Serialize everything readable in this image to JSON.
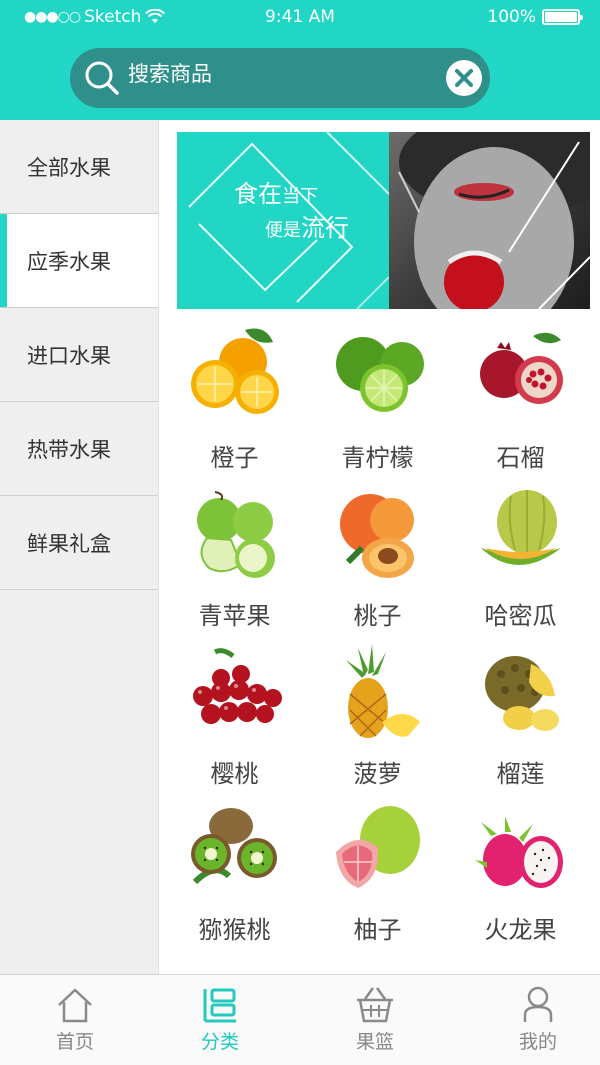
{
  "status": {
    "carrier": "Sketch",
    "time": "9:41 AM",
    "battery": "100%"
  },
  "search": {
    "placeholder": "搜索商品"
  },
  "sidebar": {
    "items": [
      {
        "label": "全部水果",
        "active": false
      },
      {
        "label": "应季水果",
        "active": true
      },
      {
        "label": "进口水果",
        "active": false
      },
      {
        "label": "热带水果",
        "active": false
      },
      {
        "label": "鲜果礼盒",
        "active": false
      }
    ]
  },
  "banner": {
    "line1_big": "食在",
    "line1_small": "当下",
    "line2_small": "便是",
    "line2_big": "流行"
  },
  "fruits": [
    {
      "name": "橙子",
      "icon": "orange-icon"
    },
    {
      "name": "青柠檬",
      "icon": "lime-icon"
    },
    {
      "name": "石榴",
      "icon": "pomegranate-icon"
    },
    {
      "name": "青苹果",
      "icon": "green-apple-icon"
    },
    {
      "name": "桃子",
      "icon": "peach-icon"
    },
    {
      "name": "哈密瓜",
      "icon": "hami-melon-icon"
    },
    {
      "name": "樱桃",
      "icon": "cherry-icon"
    },
    {
      "name": "菠萝",
      "icon": "pineapple-icon"
    },
    {
      "name": "榴莲",
      "icon": "durian-icon"
    },
    {
      "name": "猕猴桃",
      "icon": "kiwi-icon"
    },
    {
      "name": "柚子",
      "icon": "pomelo-icon"
    },
    {
      "name": "火龙果",
      "icon": "dragon-fruit-icon"
    }
  ],
  "tabs": [
    {
      "label": "首页",
      "icon": "home-icon",
      "active": false
    },
    {
      "label": "分类",
      "icon": "category-icon",
      "active": true
    },
    {
      "label": "果篮",
      "icon": "basket-icon",
      "active": false
    },
    {
      "label": "我的",
      "icon": "user-icon",
      "active": false
    }
  ],
  "colors": {
    "accent": "#22d6c6",
    "search_bg": "#2f8f8a",
    "sidebar_bg": "#efefef",
    "text": "#444444"
  }
}
